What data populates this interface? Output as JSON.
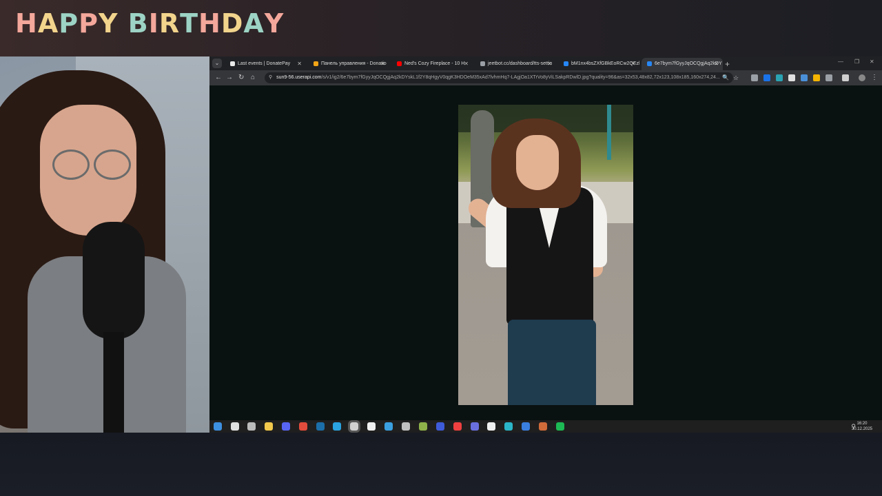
{
  "overlay": {
    "banner_text": "HAPPY BIRTHDAY",
    "banner_colors": [
      "#f4a79b",
      "#f2d48c",
      "#9cd3c4",
      "#f4a79b",
      "#f2d48c",
      "#9cd3c4",
      "#f4a79b",
      "#f2d48c",
      "#9cd3c4",
      "#f4a79b",
      "#f2d48c",
      "#9cd3c4",
      "#f4a79b",
      "#f2d48c"
    ]
  },
  "browser": {
    "tabs": [
      {
        "title": "Last events | DonatePay",
        "favicon_color": "#e9e9e9",
        "active": false
      },
      {
        "title": "Панель управления - Donatio",
        "favicon_color": "#f2a516",
        "active": false
      },
      {
        "title": "Ned's Cozy Fireplace - 10 H",
        "favicon_color": "#ff0000",
        "active": false
      },
      {
        "title": "jeetbot.cc/dashboard/tts-settin",
        "favicon_color": "#9aa0a6",
        "active": false
      },
      {
        "title": "bM1nx4bsZXfGBkEoRCw2QEzl",
        "favicon_color": "#2787f5",
        "active": false
      },
      {
        "title": "6e7bym7fGyyJqOCQgjAq2kDY",
        "favicon_color": "#2787f5",
        "active": true
      }
    ],
    "url_host": "sun9-56.userapi.com",
    "url_path": "/s/v1/ig2/6e7bym7fGyyJqOCQgjAq2kDYskL1f2Y8qHgyV0qgK3HDOeM35xAd7lvhmHq7-LAgjOa1XTrVo8yViLSakpRDwlD.jpg?quality=96&as=32x53,48x82,72x123,108x185,160x274,24..."
  },
  "taskbar": {
    "icons": [
      {
        "name": "windows-start-icon",
        "color": "#3d8fe0"
      },
      {
        "name": "search-icon",
        "color": "#e0e0e0"
      },
      {
        "name": "task-view-icon",
        "color": "#bbbbbb"
      },
      {
        "name": "file-explorer-icon",
        "color": "#f2c94c"
      },
      {
        "name": "discord-icon",
        "color": "#5865f2"
      },
      {
        "name": "chrome-icon",
        "color": "#e24c3c"
      },
      {
        "name": "steam-icon",
        "color": "#1b6ea8"
      },
      {
        "name": "telegram-icon",
        "color": "#2aa3e0"
      },
      {
        "name": "obs-icon",
        "color": "#d0d0d0"
      },
      {
        "name": "notepad-icon",
        "color": "#f0f0f0"
      },
      {
        "name": "lc-icon",
        "color": "#3aa0e0"
      },
      {
        "name": "app-icon",
        "color": "#c0c0c0"
      },
      {
        "name": "chrome-alt-icon",
        "color": "#8fb24a"
      },
      {
        "name": "t-app-icon",
        "color": "#3e5bd9"
      },
      {
        "name": "yandex-icon",
        "color": "#f04040"
      },
      {
        "name": "app2-icon",
        "color": "#6a6fe0"
      },
      {
        "name": "document-icon",
        "color": "#f0f0f0"
      },
      {
        "name": "c-app-icon",
        "color": "#2bb5c8"
      },
      {
        "name": "chart-app-icon",
        "color": "#3a7ee0"
      },
      {
        "name": "app3-icon",
        "color": "#d06b3a"
      },
      {
        "name": "spotify-icon",
        "color": "#1db954"
      }
    ],
    "time": "16:20",
    "date": "30.12.2025"
  }
}
